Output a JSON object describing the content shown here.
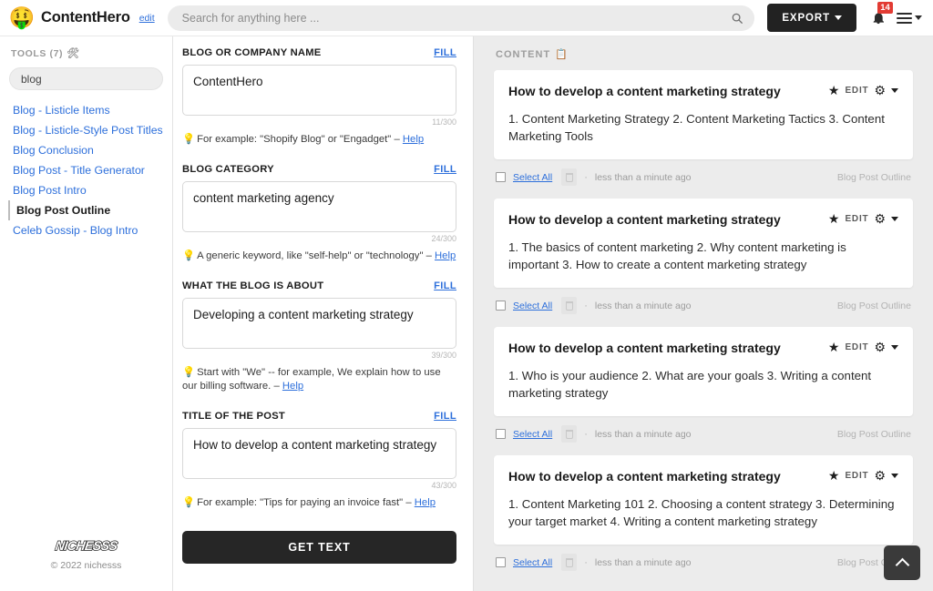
{
  "header": {
    "logo_emoji": "🤑",
    "brand_name": "ContentHero",
    "edit_label": "edit",
    "search_placeholder": "Search for anything here ...",
    "search_value": "",
    "export_label": "EXPORT",
    "notification_count": "14"
  },
  "sidebar": {
    "tools_heading": "TOOLS (7)",
    "tools_icon": "🛠",
    "filter_value": "blog",
    "filter_placeholder": "blog",
    "items": [
      {
        "label": "Blog - Listicle Items",
        "active": false
      },
      {
        "label": "Blog - Listicle-Style Post Titles",
        "active": false
      },
      {
        "label": "Blog Conclusion",
        "active": false
      },
      {
        "label": "Blog Post - Title Generator",
        "active": false
      },
      {
        "label": "Blog Post Intro",
        "active": false
      },
      {
        "label": "Blog Post Outline",
        "active": true
      },
      {
        "label": "Celeb Gossip - Blog Intro",
        "active": false
      }
    ],
    "logo_text": "NICHESSS",
    "copyright": "© 2022 nichesss"
  },
  "form": {
    "fill_label": "FILL",
    "fields": [
      {
        "label": "BLOG OR COMPANY NAME",
        "value": "ContentHero",
        "count": "11/300",
        "hint_prefix": "For example: \"Shopify Blog\" or \"Engadget\" – ",
        "hint_link": "Help"
      },
      {
        "label": "BLOG CATEGORY",
        "value": "content marketing agency",
        "count": "24/300",
        "hint_prefix": "A generic keyword, like \"self-help\" or \"technology\" – ",
        "hint_link": "Help"
      },
      {
        "label": "WHAT THE BLOG IS ABOUT",
        "value": "Developing a content marketing strategy",
        "count": "39/300",
        "hint_prefix": "Start with \"We\" -- for example, We explain how to use our billing software. – ",
        "hint_link": "Help"
      },
      {
        "label": "TITLE OF THE POST",
        "value": "How to develop a content marketing strategy",
        "count": "43/300",
        "hint_prefix": "For example: \"Tips for paying an invoice fast\" – ",
        "hint_link": "Help"
      }
    ],
    "submit_label": "GET TEXT"
  },
  "content": {
    "heading": "CONTENT",
    "heading_icon": "📋",
    "select_all_label": "Select All",
    "edit_label": "EDIT",
    "star_glyph": "★",
    "gear_glyph": "⚙",
    "dot_separator": "·",
    "cards": [
      {
        "title": "How to develop a content marketing strategy",
        "body": "1. Content Marketing Strategy 2. Content Marketing Tactics 3. Content Marketing Tools",
        "time": "less than a minute ago",
        "tag": "Blog Post Outline"
      },
      {
        "title": "How to develop a content marketing strategy",
        "body": "1. The basics of content marketing 2. Why content marketing is important 3. How to create a content marketing strategy",
        "time": "less than a minute ago",
        "tag": "Blog Post Outline"
      },
      {
        "title": "How to develop a content marketing strategy",
        "body": "1. Who is your audience 2. What are your goals 3. Writing a content marketing strategy",
        "time": "less than a minute ago",
        "tag": "Blog Post Outline"
      },
      {
        "title": "How to develop a content marketing strategy",
        "body": "1. Content Marketing 101 2. Choosing a content strategy 3. Determining your target market 4. Writing a content marketing strategy",
        "time": "less than a minute ago",
        "tag": "Blog Post Outline"
      }
    ]
  },
  "colors": {
    "accent_link": "#2d6fdb",
    "dark_button": "#262626",
    "badge_red": "#e23b33",
    "panel_bg": "#ececec"
  }
}
